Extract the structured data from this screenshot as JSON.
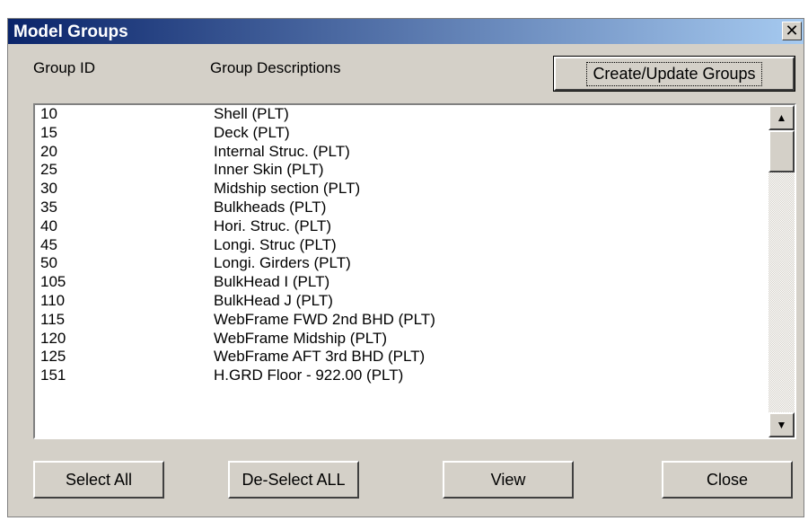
{
  "window": {
    "title": "Model Groups",
    "close_glyph": "✕"
  },
  "headers": {
    "group_id": "Group ID",
    "descriptions": "Group Descriptions"
  },
  "buttons": {
    "create_update": "Create/Update Groups",
    "select_all": "Select All",
    "deselect_all": "De-Select ALL",
    "view": "View",
    "close": "Close"
  },
  "rows": [
    {
      "id": "10",
      "desc": "Shell (PLT)"
    },
    {
      "id": "15",
      "desc": "Deck (PLT)"
    },
    {
      "id": "20",
      "desc": "Internal Struc. (PLT)"
    },
    {
      "id": "25",
      "desc": "Inner Skin (PLT)"
    },
    {
      "id": "30",
      "desc": "Midship section (PLT)"
    },
    {
      "id": "35",
      "desc": "Bulkheads (PLT)"
    },
    {
      "id": "40",
      "desc": "Hori. Struc. (PLT)"
    },
    {
      "id": "45",
      "desc": "Longi. Struc (PLT)"
    },
    {
      "id": "50",
      "desc": "Longi. Girders (PLT)"
    },
    {
      "id": "105",
      "desc": "BulkHead I (PLT)"
    },
    {
      "id": "110",
      "desc": "BulkHead J (PLT)"
    },
    {
      "id": "115",
      "desc": "WebFrame FWD 2nd BHD (PLT)"
    },
    {
      "id": "120",
      "desc": "WebFrame Midship (PLT)"
    },
    {
      "id": "125",
      "desc": "WebFrame AFT 3rd BHD (PLT)"
    },
    {
      "id": "151",
      "desc": "H.GRD Floor - 922.00 (PLT)"
    }
  ],
  "colors": {
    "titlebar_start": "#0a246a",
    "titlebar_end": "#a6caf0",
    "face": "#d4d0c8"
  }
}
